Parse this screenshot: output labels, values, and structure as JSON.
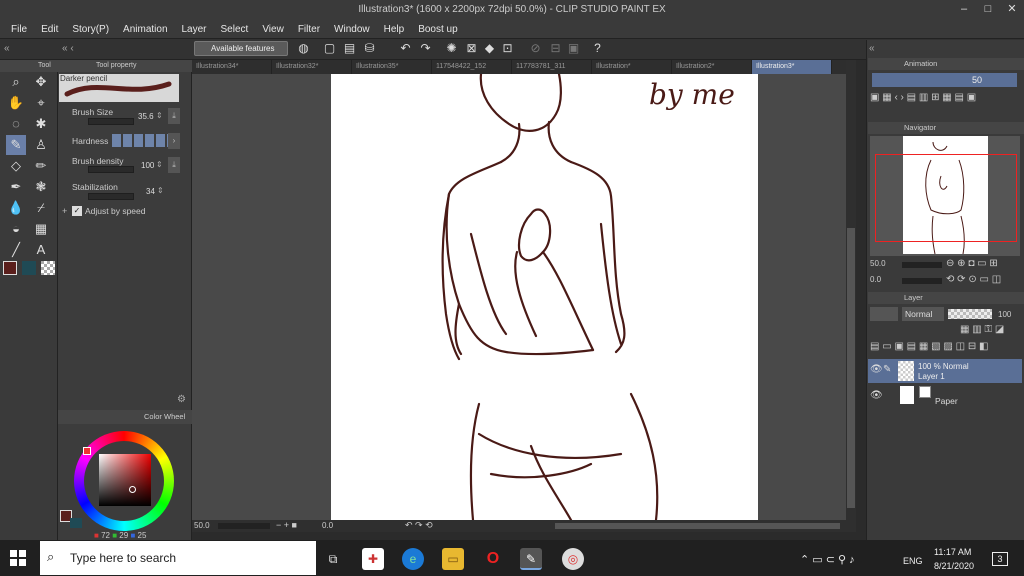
{
  "window": {
    "title": "Illustration3* (1600 x 2200px 72dpi 50.0%) - CLIP STUDIO PAINT EX",
    "min": "–",
    "max": "□",
    "close": "✕"
  },
  "menu": [
    "File",
    "Edit",
    "Story(P)",
    "Animation",
    "Layer",
    "Select",
    "View",
    "Filter",
    "Window",
    "Help",
    "Boost up"
  ],
  "command_bar": {
    "available_features": "Available features"
  },
  "tool_panel": {
    "title": "Tool"
  },
  "subtool": {
    "title": "Tool property",
    "brush_name": "Darker pencil"
  },
  "properties": {
    "brush_size_label": "Brush Size",
    "brush_size_value": "35.6",
    "hardness_label": "Hardness",
    "brush_density_label": "Brush density",
    "brush_density_value": "100",
    "stabilization_label": "Stabilization",
    "stabilization_value": "34",
    "adjust_speed_label": "Adjust by speed"
  },
  "color_wheel": {
    "title": "Color Wheel",
    "r": "72",
    "g": "29",
    "b": "25"
  },
  "colors": {
    "main": "#5a1f1c",
    "sub": "#1f4a55",
    "accent": "#5a6f96",
    "stroke": "#4a1a16"
  },
  "tabs": [
    "Illustration34*",
    "Illustration32*",
    "Illustration35*",
    "117548422_152",
    "117783781_311",
    "Illustration*",
    "Illustration2*",
    "Illustration3*"
  ],
  "canvas": {
    "signature": "by me",
    "zoom": "50.0",
    "rotation": "0.0"
  },
  "animation_panel": {
    "title": "Animation",
    "value": "50"
  },
  "navigator": {
    "title": "Navigator",
    "zoom": "50.0",
    "rotation": "0.0"
  },
  "layer_panel": {
    "title": "Layer",
    "blend_mode": "Normal",
    "opacity": "100",
    "layers": [
      {
        "line1": "100 % Normal",
        "line2": "Layer 1"
      },
      {
        "line1": "",
        "line2": "Paper"
      }
    ]
  },
  "taskbar": {
    "search_placeholder": "Type here to search",
    "language": "ENG",
    "time": "11:17 AM",
    "date": "8/21/2020",
    "notifications": "3"
  }
}
